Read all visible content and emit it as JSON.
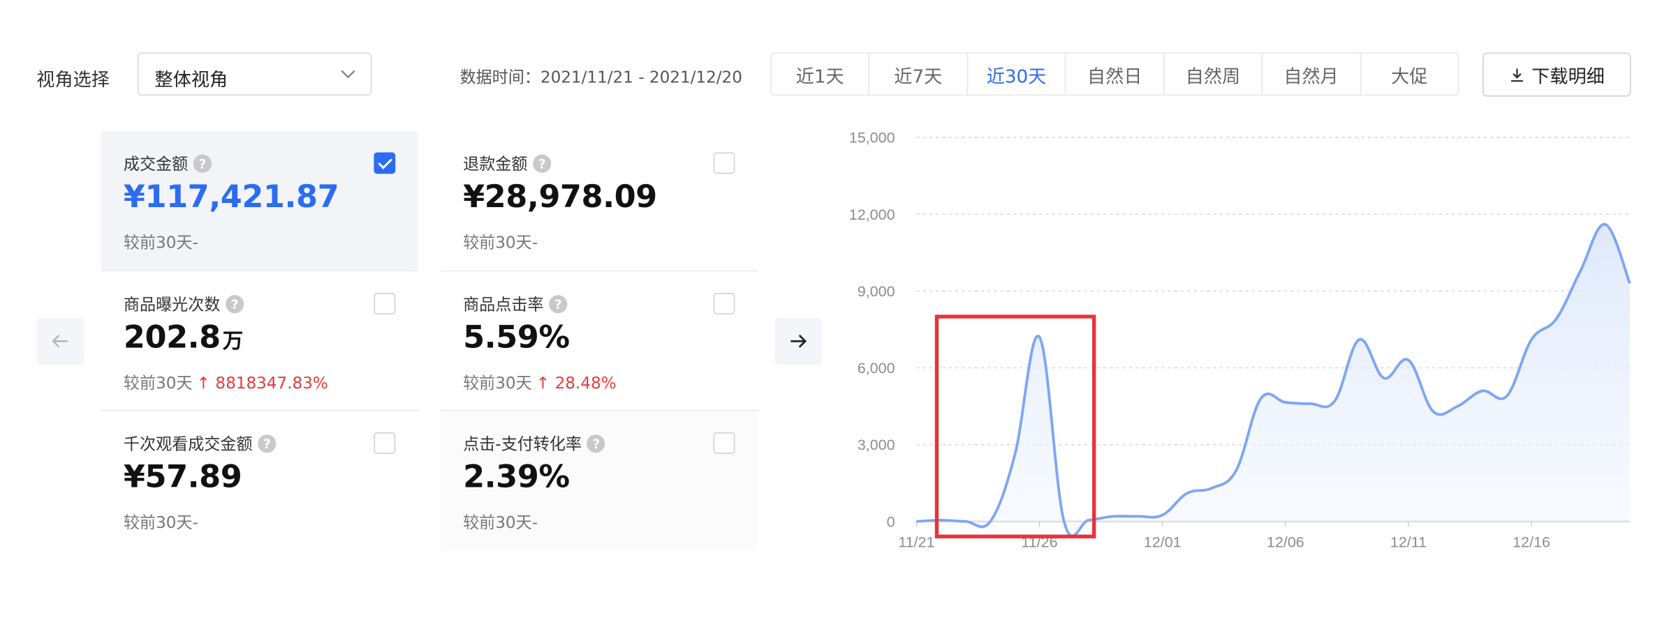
{
  "perspective": {
    "label": "视角选择",
    "value": "整体视角"
  },
  "time": {
    "label": "数据时间：",
    "range": "2021/11/21 - 2021/12/20"
  },
  "range_tabs": [
    {
      "label": "近1天"
    },
    {
      "label": "近7天"
    },
    {
      "label": "近30天",
      "active": true
    },
    {
      "label": "自然日"
    },
    {
      "label": "自然周"
    },
    {
      "label": "自然月"
    },
    {
      "label": "大促"
    }
  ],
  "download_label": "下载明细",
  "metrics": [
    {
      "title": "成交金额",
      "value": "¥117,421.87",
      "unit": "",
      "compare": "较前30天-",
      "change": "",
      "checked": true
    },
    {
      "title": "退款金额",
      "value": "¥28,978.09",
      "unit": "",
      "compare": "较前30天-",
      "change": "",
      "checked": false
    },
    {
      "title": "商品曝光次数",
      "value": "202.8",
      "unit": "万",
      "compare": "较前30天",
      "change": "8818347.83%",
      "checked": false
    },
    {
      "title": "商品点击率",
      "value": "5.59%",
      "unit": "",
      "compare": "较前30天",
      "change": "28.48%",
      "checked": false
    },
    {
      "title": "千次观看成交金额",
      "value": "¥57.89",
      "unit": "",
      "compare": "较前30天-",
      "change": "",
      "checked": false
    },
    {
      "title": "点击-支付转化率",
      "value": "2.39%",
      "unit": "",
      "compare": "较前30天-",
      "change": "",
      "checked": false
    }
  ],
  "colors": {
    "accent": "#2b6cf2",
    "line": "#7ea6f4",
    "increase": "#e83a3a",
    "highlight_box": "#e8333a"
  },
  "icons": {
    "prev": "arrow-left-icon",
    "next": "arrow-right-icon",
    "download": "download-icon",
    "help": "question-circle-icon",
    "dropdown": "chevron-down-icon"
  },
  "chart_data": {
    "type": "area",
    "x": [
      "11/21",
      "11/22",
      "11/23",
      "11/24",
      "11/25",
      "11/26",
      "11/27",
      "11/28",
      "11/29",
      "11/30",
      "12/01",
      "12/02",
      "12/03",
      "12/04",
      "12/05",
      "12/06",
      "12/07",
      "12/08",
      "12/09",
      "12/10",
      "12/11",
      "12/12",
      "12/13",
      "12/14",
      "12/15",
      "12/16",
      "12/17",
      "12/18",
      "12/19",
      "12/20"
    ],
    "values": [
      0,
      50,
      0,
      0,
      2600,
      7200,
      0,
      50,
      200,
      200,
      250,
      1100,
      1300,
      2000,
      4800,
      4650,
      4600,
      4700,
      7100,
      5600,
      6300,
      4300,
      4500,
      5100,
      4900,
      7100,
      7900,
      9800,
      11600,
      9300
    ],
    "xticks": [
      "11/21",
      "11/26",
      "12/01",
      "12/06",
      "12/11",
      "12/16"
    ],
    "yticks": [
      "0",
      "3,000",
      "6,000",
      "9,000",
      "12,000",
      "15,000"
    ],
    "ylim": [
      0,
      15000
    ],
    "grid": true,
    "highlight": {
      "from": "11/22",
      "to": "11/28"
    }
  }
}
